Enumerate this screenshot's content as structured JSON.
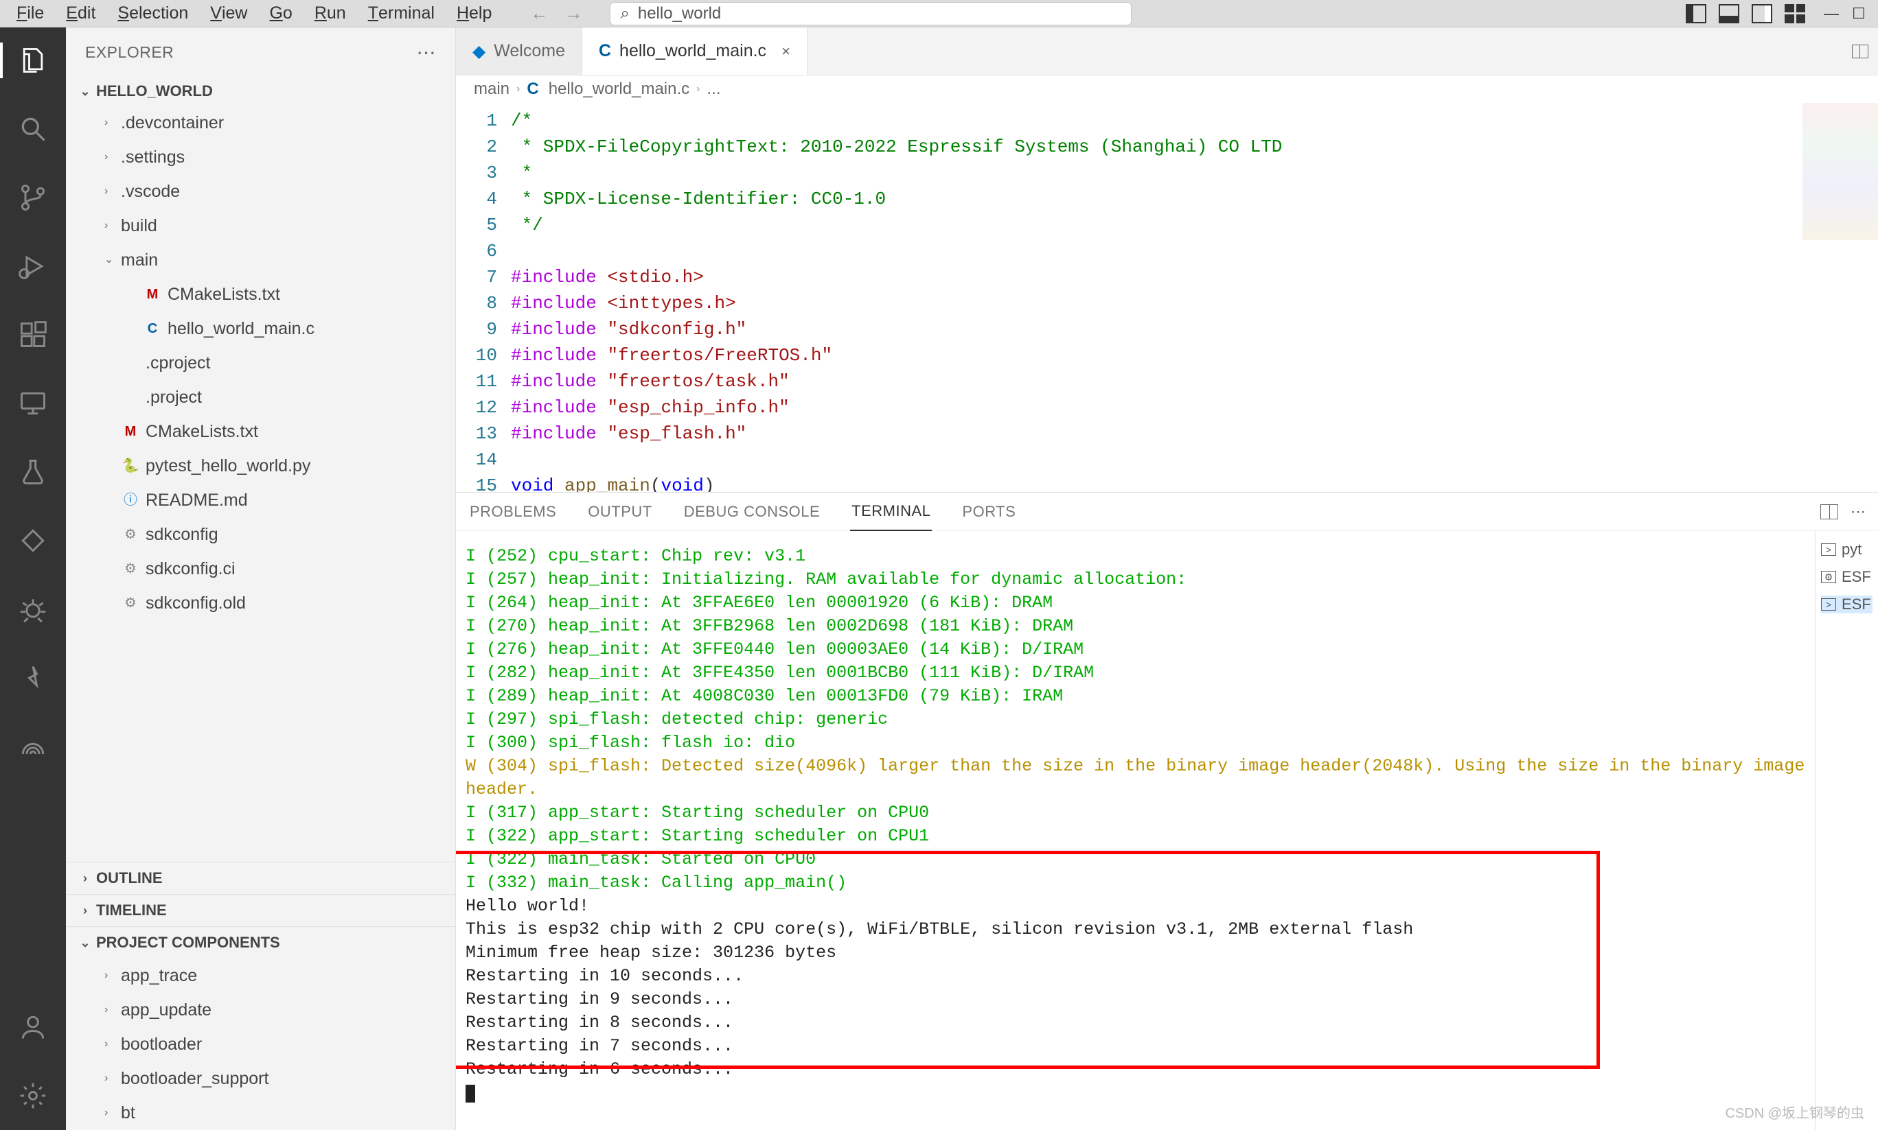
{
  "menubar": {
    "items": [
      "File",
      "Edit",
      "Selection",
      "View",
      "Go",
      "Run",
      "Terminal",
      "Help"
    ],
    "search_text": "hello_world"
  },
  "sidebar": {
    "title": "EXPLORER",
    "workspace": "HELLO_WORLD",
    "folders": [
      {
        "name": ".devcontainer",
        "kind": "folder",
        "expanded": false,
        "indent": 1
      },
      {
        "name": ".settings",
        "kind": "folder",
        "expanded": false,
        "indent": 1
      },
      {
        "name": ".vscode",
        "kind": "folder",
        "expanded": false,
        "indent": 1
      },
      {
        "name": "build",
        "kind": "folder",
        "expanded": false,
        "indent": 1
      },
      {
        "name": "main",
        "kind": "folder",
        "expanded": true,
        "indent": 1
      },
      {
        "name": "CMakeLists.txt",
        "kind": "file",
        "icon": "M",
        "indent": 2
      },
      {
        "name": "hello_world_main.c",
        "kind": "file",
        "icon": "C",
        "indent": 2
      },
      {
        "name": ".cproject",
        "kind": "file",
        "icon": "",
        "indent": 1
      },
      {
        "name": ".project",
        "kind": "file",
        "icon": "",
        "indent": 1
      },
      {
        "name": "CMakeLists.txt",
        "kind": "file",
        "icon": "M",
        "indent": 1
      },
      {
        "name": "pytest_hello_world.py",
        "kind": "file",
        "icon": "py",
        "indent": 1
      },
      {
        "name": "README.md",
        "kind": "file",
        "icon": "info",
        "indent": 1
      },
      {
        "name": "sdkconfig",
        "kind": "file",
        "icon": "gear",
        "indent": 1
      },
      {
        "name": "sdkconfig.ci",
        "kind": "file",
        "icon": "gear",
        "indent": 1
      },
      {
        "name": "sdkconfig.old",
        "kind": "file",
        "icon": "gear",
        "indent": 1
      }
    ],
    "outline": "OUTLINE",
    "timeline": "TIMELINE",
    "project_components": "PROJECT COMPONENTS",
    "components": [
      {
        "name": "app_trace"
      },
      {
        "name": "app_update"
      },
      {
        "name": "bootloader"
      },
      {
        "name": "bootloader_support"
      },
      {
        "name": "bt"
      }
    ]
  },
  "tabs": {
    "welcome": "Welcome",
    "file": "hello_world_main.c"
  },
  "breadcrumb": {
    "0": "main",
    "1": "hello_world_main.c",
    "2": "..."
  },
  "code": {
    "lines": [
      {
        "n": "1",
        "html": "<span class='tok-comment'>/*</span>"
      },
      {
        "n": "2",
        "html": "<span class='tok-comment'> * SPDX-FileCopyrightText: 2010-2022 Espressif Systems (Shanghai) CO LTD</span>"
      },
      {
        "n": "3",
        "html": "<span class='tok-comment'> *</span>"
      },
      {
        "n": "4",
        "html": "<span class='tok-comment'> * SPDX-License-Identifier: CC0-1.0</span>"
      },
      {
        "n": "5",
        "html": "<span class='tok-comment'> */</span>"
      },
      {
        "n": "6",
        "html": ""
      },
      {
        "n": "7",
        "html": "<span class='tok-pp'>#include</span> <span class='tok-str'>&lt;stdio.h&gt;</span>"
      },
      {
        "n": "8",
        "html": "<span class='tok-pp'>#include</span> <span class='tok-str'>&lt;inttypes.h&gt;</span>"
      },
      {
        "n": "9",
        "html": "<span class='tok-pp'>#include</span> <span class='tok-str'>\"sdkconfig.h\"</span>"
      },
      {
        "n": "10",
        "html": "<span class='tok-pp'>#include</span> <span class='tok-str'>\"freertos/FreeRTOS.h\"</span>"
      },
      {
        "n": "11",
        "html": "<span class='tok-pp'>#include</span> <span class='tok-str'>\"freertos/task.h\"</span>"
      },
      {
        "n": "12",
        "html": "<span class='tok-pp'>#include</span> <span class='tok-str'>\"esp_chip_info.h\"</span>"
      },
      {
        "n": "13",
        "html": "<span class='tok-pp'>#include</span> <span class='tok-str'>\"esp_flash.h\"</span>"
      },
      {
        "n": "14",
        "html": ""
      },
      {
        "n": "15",
        "html": "<span class='tok-kw'>void</span> <span class='tok-fn'>app_main</span>(<span class='tok-kw'>void</span>)"
      }
    ]
  },
  "panel": {
    "tabs": {
      "problems": "PROBLEMS",
      "output": "OUTPUT",
      "debug": "DEBUG CONSOLE",
      "terminal": "TERMINAL",
      "ports": "PORTS"
    },
    "side": [
      {
        "label": "pyt",
        "icon": ">"
      },
      {
        "label": "ESF",
        "icon": "⚙"
      },
      {
        "label": "ESF",
        "icon": ">",
        "active": true
      }
    ],
    "terminal": [
      {
        "cls": "info",
        "text": "I (252) cpu_start: Chip rev:         v3.1"
      },
      {
        "cls": "info",
        "text": "I (257) heap_init: Initializing. RAM available for dynamic allocation:"
      },
      {
        "cls": "info",
        "text": "I (264) heap_init: At 3FFAE6E0 len 00001920 (6 KiB): DRAM"
      },
      {
        "cls": "info",
        "text": "I (270) heap_init: At 3FFB2968 len 0002D698 (181 KiB): DRAM"
      },
      {
        "cls": "info",
        "text": "I (276) heap_init: At 3FFE0440 len 00003AE0 (14 KiB): D/IRAM"
      },
      {
        "cls": "info",
        "text": "I (282) heap_init: At 3FFE4350 len 0001BCB0 (111 KiB): D/IRAM"
      },
      {
        "cls": "info",
        "text": "I (289) heap_init: At 4008C030 len 00013FD0 (79 KiB): IRAM"
      },
      {
        "cls": "info",
        "text": "I (297) spi_flash: detected chip: generic"
      },
      {
        "cls": "info",
        "text": "I (300) spi_flash: flash io: dio"
      },
      {
        "cls": "warn",
        "text": "W (304) spi_flash: Detected size(4096k) larger than the size in the binary image header(2048k). Using the size in the binary image header."
      },
      {
        "cls": "info",
        "text": "I (317) app_start: Starting scheduler on CPU0"
      },
      {
        "cls": "info",
        "text": "I (322) app_start: Starting scheduler on CPU1"
      },
      {
        "cls": "info",
        "text": "I (322) main_task: Started on CPU0"
      },
      {
        "cls": "info",
        "text": "I (332) main_task: Calling app_main()"
      },
      {
        "cls": "plain",
        "text": "Hello world!"
      },
      {
        "cls": "plain",
        "text": "This is esp32 chip with 2 CPU core(s), WiFi/BTBLE, silicon revision v3.1, 2MB external flash"
      },
      {
        "cls": "plain",
        "text": "Minimum free heap size: 301236 bytes"
      },
      {
        "cls": "plain",
        "text": "Restarting in 10 seconds..."
      },
      {
        "cls": "plain",
        "text": "Restarting in 9 seconds..."
      },
      {
        "cls": "plain",
        "text": "Restarting in 8 seconds..."
      },
      {
        "cls": "plain",
        "text": "Restarting in 7 seconds..."
      },
      {
        "cls": "plain",
        "text": "Restarting in 6 seconds..."
      }
    ]
  },
  "watermark": "CSDN @坂上钢琴的虫"
}
